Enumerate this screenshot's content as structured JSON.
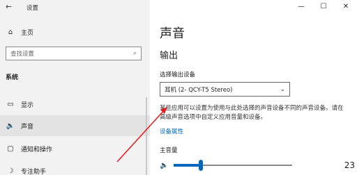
{
  "window": {
    "back_icon": "back-arrow-icon",
    "title": "设置",
    "controls": {
      "minimize": "—",
      "maximize": "☐",
      "close": "✕"
    }
  },
  "sidebar": {
    "home_label": "主页",
    "search_placeholder": "查找设置",
    "section": "系统",
    "items": [
      {
        "label": "显示",
        "icon": "monitor-icon"
      },
      {
        "label": "声音",
        "icon": "speaker-icon",
        "active": true
      },
      {
        "label": "通知和操作",
        "icon": "notification-icon"
      },
      {
        "label": "专注助手",
        "icon": "focus-assist-icon"
      }
    ]
  },
  "main": {
    "title": "声音",
    "output_heading": "输出",
    "device_label": "选择输出设备",
    "device_value": "耳机 (2- QCY-T5 Stereo)",
    "description": "某些应用可以设置为使用与此处选择的声音设备不同的声音设备。请在高级声音选项中自定义应用音量和设备。",
    "device_props_link": "设备属性",
    "volume_label": "主音量",
    "volume_value": "23",
    "volume_level": 0.23
  },
  "colors": {
    "accent": "#0067c0",
    "annotation_arrow": "#e02020"
  }
}
